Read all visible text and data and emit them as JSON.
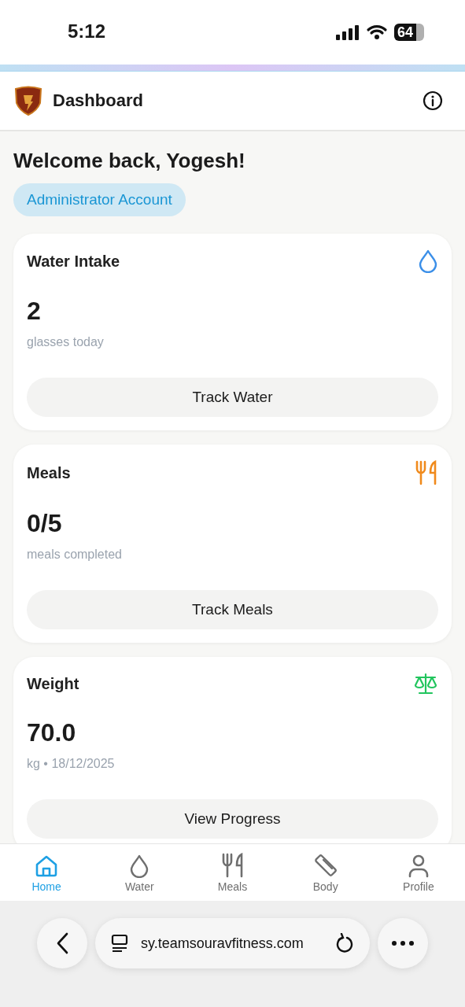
{
  "status_bar": {
    "time": "5:12",
    "battery": "64"
  },
  "header": {
    "title": "Dashboard"
  },
  "welcome": {
    "heading": "Welcome back, Yogesh!",
    "badge": "Administrator Account"
  },
  "cards": [
    {
      "title": "Water Intake",
      "kind": "drop",
      "color": "#3b8fe8",
      "value": "2",
      "caption": "glasses today",
      "button": "Track Water"
    },
    {
      "title": "Meals",
      "kind": "utensils",
      "color": "#f08a1c",
      "value": "0/5",
      "caption": "meals completed",
      "button": "Track Meals"
    },
    {
      "title": "Weight",
      "kind": "scale",
      "color": "#22c55e",
      "value": "70.0",
      "caption": "kg • 18/12/2025",
      "button": "View Progress"
    }
  ],
  "bottom_nav": [
    {
      "label": "Home",
      "kind": "home",
      "selected": true
    },
    {
      "label": "Water",
      "kind": "drop",
      "selected": false
    },
    {
      "label": "Meals",
      "kind": "utensils",
      "selected": false
    },
    {
      "label": "Body",
      "kind": "ruler",
      "selected": false
    },
    {
      "label": "Profile",
      "kind": "person",
      "selected": false
    }
  ],
  "browser": {
    "url": "sy.teamsouravfitness.com"
  }
}
